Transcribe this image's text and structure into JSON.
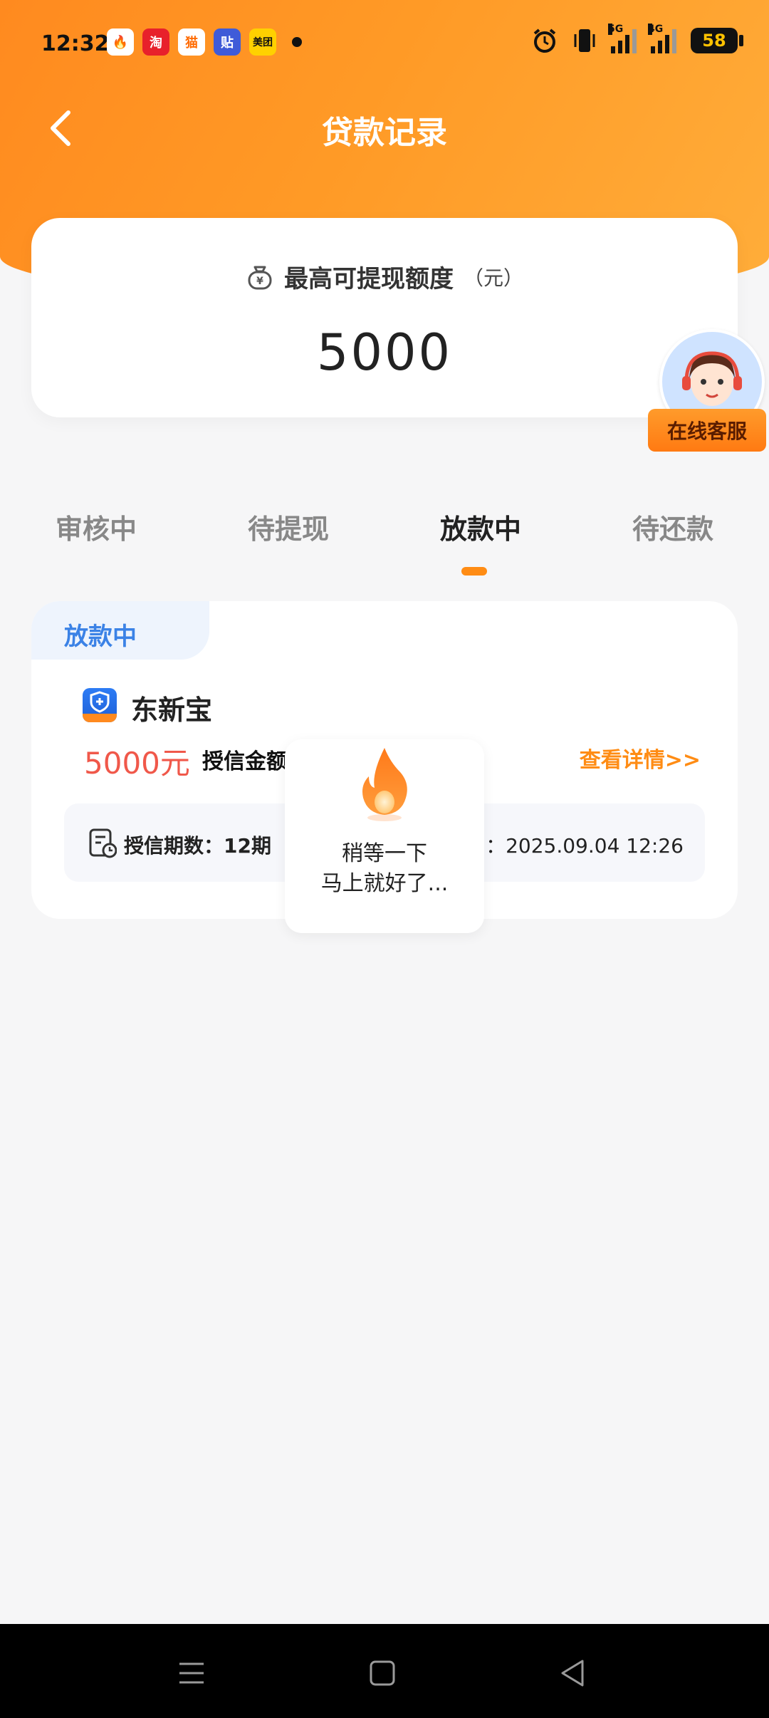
{
  "status_bar": {
    "time": "12:32",
    "apps": [
      {
        "name": "flame-app-icon",
        "glyph": "🔥",
        "bg": "#ffffff"
      },
      {
        "name": "taobao-app-icon",
        "glyph": "淘",
        "bg": "#e8212b"
      },
      {
        "name": "tmall-app-icon",
        "glyph": "猫",
        "bg": "#ffffff"
      },
      {
        "name": "tie-app-icon",
        "glyph": "贴",
        "bg": "#3f5bd8"
      },
      {
        "name": "meituan-app-icon",
        "glyph": "美团",
        "bg": "#ffd100"
      }
    ],
    "net1": "5G",
    "net2": "4G",
    "battery": "58"
  },
  "header": {
    "title": "贷款记录"
  },
  "quota": {
    "label": "最高可提现额度",
    "unit": "（元）",
    "value": "5000"
  },
  "service": {
    "label": "在线客服"
  },
  "tabs": [
    {
      "label": "审核中",
      "active": false
    },
    {
      "label": "待提现",
      "active": false
    },
    {
      "label": "放款中",
      "active": true
    },
    {
      "label": "待还款",
      "active": false
    }
  ],
  "record": {
    "status_tag": "放款中",
    "product_name": "东新宝",
    "amount": "5000元",
    "amount_label": "授信金额",
    "detail_link": "查看详情>>",
    "term": "授信期数：12期",
    "time_partial": "间：2025.09.04  12:26"
  },
  "loading": {
    "line1": "稍等一下",
    "line2": "马上就好了..."
  },
  "colors": {
    "accent": "#ff8c14",
    "amount": "#f0584a",
    "tag_blue": "#3b82e6"
  }
}
